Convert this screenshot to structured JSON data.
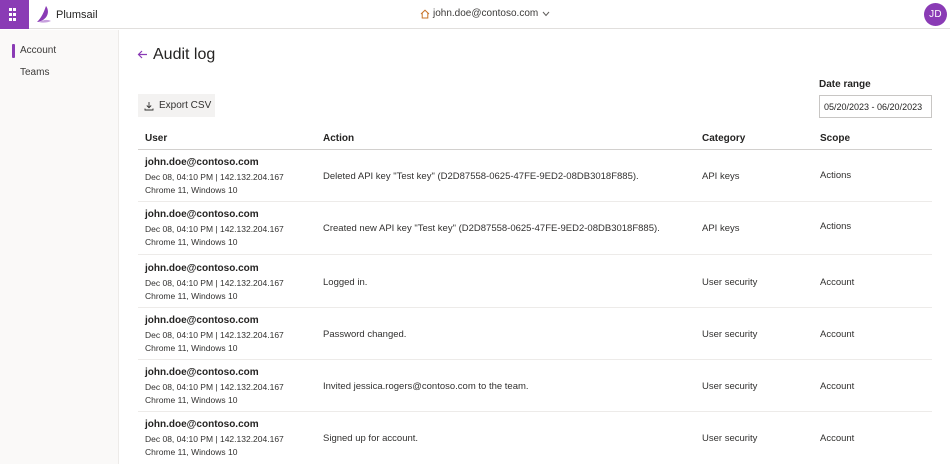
{
  "header": {
    "brand": "Plumsail",
    "account_email": "john.doe@contoso.com",
    "avatar_initials": "JD",
    "accent_color": "#8a3bb5"
  },
  "sidebar": {
    "items": [
      {
        "label": "Account",
        "active": true
      },
      {
        "label": "Teams",
        "active": false
      }
    ]
  },
  "page": {
    "title": "Audit log",
    "export_label": "Export CSV",
    "date_range_label": "Date range",
    "date_range_value": "05/20/2023 - 06/20/2023"
  },
  "table": {
    "columns": [
      "User",
      "Action",
      "Category",
      "Scope"
    ],
    "rows": [
      {
        "user": "john.doe@contoso.com",
        "meta": "Dec 08, 04:10 PM | 142.132.204.167",
        "client": "Chrome 11, Windows 10",
        "action": "Deleted API key \"Test key\" (D2D87558-0625-47FE-9ED2-08DB3018F885).",
        "category": "API keys",
        "scope": "Actions"
      },
      {
        "user": "john.doe@contoso.com",
        "meta": "Dec 08, 04:10 PM | 142.132.204.167",
        "client": "Chrome 11, Windows 10",
        "action": "Created new API key \"Test key\" (D2D87558-0625-47FE-9ED2-08DB3018F885).",
        "category": "API keys",
        "scope": "Actions"
      },
      {
        "user": "john.doe@contoso.com",
        "meta": "Dec 08, 04:10 PM | 142.132.204.167",
        "client": "Chrome 11, Windows 10",
        "action": "Logged in.",
        "category": "User security",
        "scope": "Account"
      },
      {
        "user": "john.doe@contoso.com",
        "meta": "Dec 08, 04:10 PM | 142.132.204.167",
        "client": "Chrome 11, Windows 10",
        "action": "Password changed.",
        "category": "User security",
        "scope": "Account"
      },
      {
        "user": "john.doe@contoso.com",
        "meta": "Dec 08, 04:10 PM | 142.132.204.167",
        "client": "Chrome 11, Windows 10",
        "action": "Invited jessica.rogers@contoso.com to the team.",
        "category": "User security",
        "scope": "Account"
      },
      {
        "user": "john.doe@contoso.com",
        "meta": "Dec 08, 04:10 PM | 142.132.204.167",
        "client": "Chrome 11, Windows 10",
        "action": "Signed up for account.",
        "category": "User security",
        "scope": "Account"
      }
    ]
  }
}
